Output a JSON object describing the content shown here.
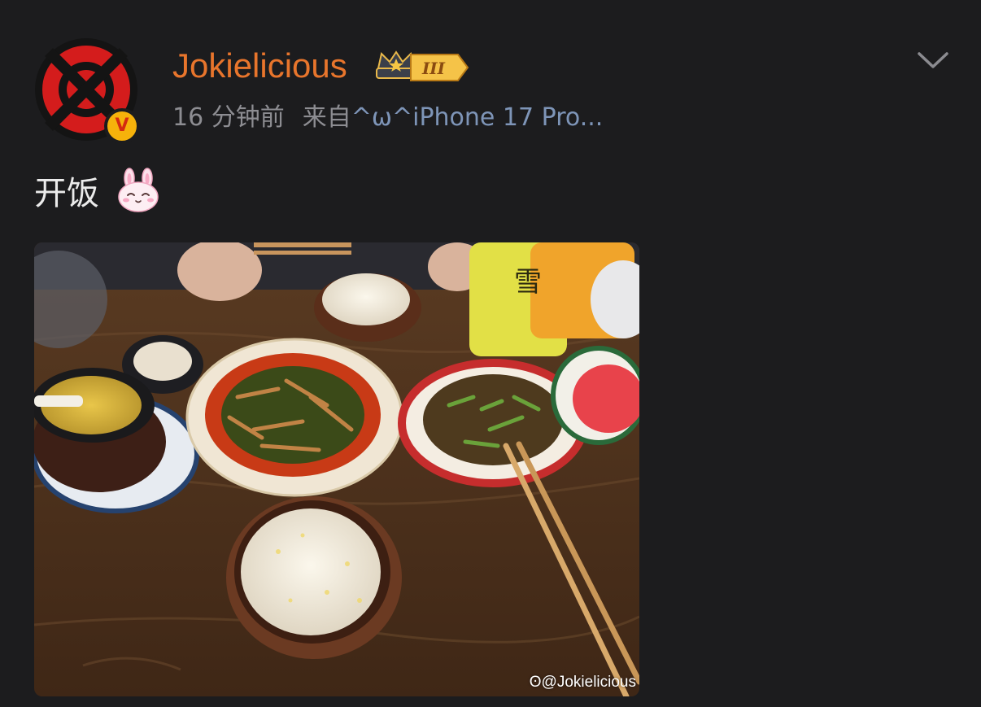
{
  "post": {
    "username": "Jokielicious",
    "level_badge": "III",
    "time": "16 分钟前",
    "source_prefix": "来自",
    "source_device": "^ω^iPhone 17 Pro...",
    "text": "开饭",
    "emoji_icon": "rabbit-face-icon",
    "photo_alt": "",
    "watermark": "@Jokielicious"
  },
  "colors": {
    "background": "#1c1c1e",
    "username": "#e8752c",
    "meta": "#8d8d92",
    "device_link": "#7e95b8",
    "verified_badge": "#f6b20b"
  }
}
